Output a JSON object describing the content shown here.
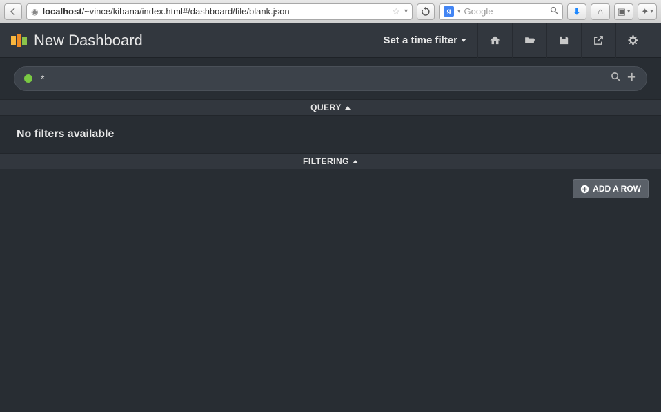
{
  "browser": {
    "url_host": "localhost",
    "url_path": "/~vince/kibana/index.html#/dashboard/file/blank.json",
    "search_engine_letter": "g",
    "search_placeholder": "Google"
  },
  "header": {
    "title": "New Dashboard",
    "time_filter_label": "Set a time filter"
  },
  "query": {
    "value": "*"
  },
  "sections": {
    "query_label": "QUERY",
    "filtering_label": "FILTERING",
    "no_filters": "No filters available"
  },
  "actions": {
    "add_row": "ADD A ROW"
  }
}
